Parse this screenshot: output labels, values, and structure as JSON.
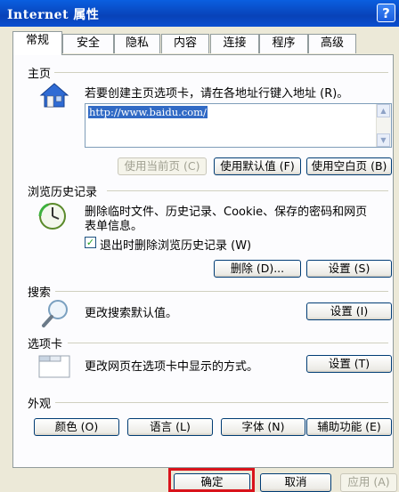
{
  "window": {
    "title": "Internet 属性",
    "help_label": "?"
  },
  "tabs": [
    "常规",
    "安全",
    "隐私",
    "内容",
    "连接",
    "程序",
    "高级"
  ],
  "homepage": {
    "section_title": "主页",
    "instruction": "若要创建主页选项卡，请在各地址行键入地址 (R)。",
    "url": "http://www.baidu.com/",
    "buttons": {
      "use_current": "使用当前页 (C)",
      "use_default": "使用默认值 (F)",
      "use_blank": "使用空白页 (B)"
    }
  },
  "history": {
    "section_title": "浏览历史记录",
    "description_line1": "删除临时文件、历史记录、Cookie、保存的密码和网页",
    "description_line2": "表单信息。",
    "checkbox_label": "退出时删除浏览历史记录 (W)",
    "checkbox_checked": true,
    "delete_button": "删除 (D)...",
    "settings_button": "设置 (S)"
  },
  "search": {
    "section_title": "搜索",
    "description": "更改搜索默认值。",
    "settings_button": "设置 (I)"
  },
  "tabs_section": {
    "section_title": "选项卡",
    "description": "更改网页在选项卡中显示的方式。",
    "settings_button": "设置 (T)"
  },
  "appearance": {
    "section_title": "外观",
    "buttons": [
      "颜色 (O)",
      "语言 (L)",
      "字体 (N)",
      "辅助功能 (E)"
    ]
  },
  "footer": {
    "ok": "确定",
    "cancel": "取消",
    "apply": "应用 (A)"
  }
}
